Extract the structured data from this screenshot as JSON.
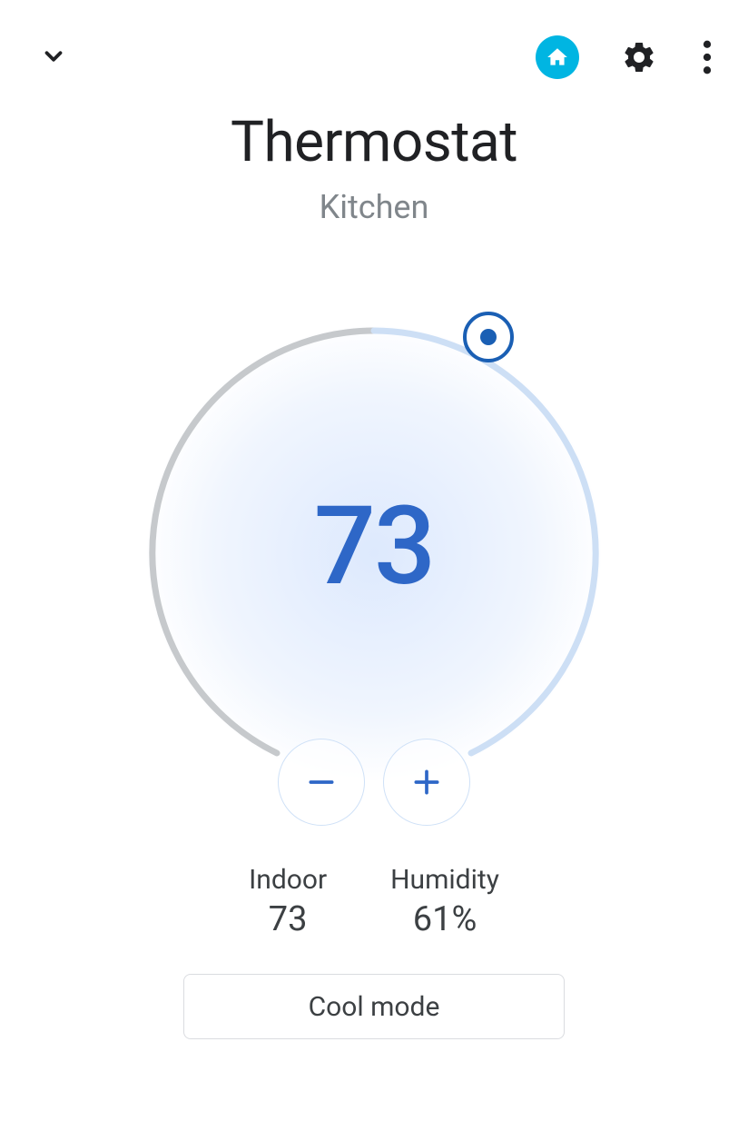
{
  "header": {
    "icons": {
      "collapse": "chevron-down",
      "home": "home",
      "settings": "gear",
      "more": "more-vert"
    }
  },
  "title": "Thermostat",
  "room": "Kitchen",
  "thermostat": {
    "setpoint": "73",
    "handle_angle_deg": 27,
    "colors": {
      "accent": "#2e67c7",
      "ring_inactive": "#c6c9cc",
      "ring_active": "#cddff5"
    }
  },
  "controls": {
    "decrease": "−",
    "increase": "+"
  },
  "stats": {
    "indoor_label": "Indoor",
    "indoor_value": "73",
    "humidity_label": "Humidity",
    "humidity_value": "61%"
  },
  "mode_button": "Cool mode"
}
